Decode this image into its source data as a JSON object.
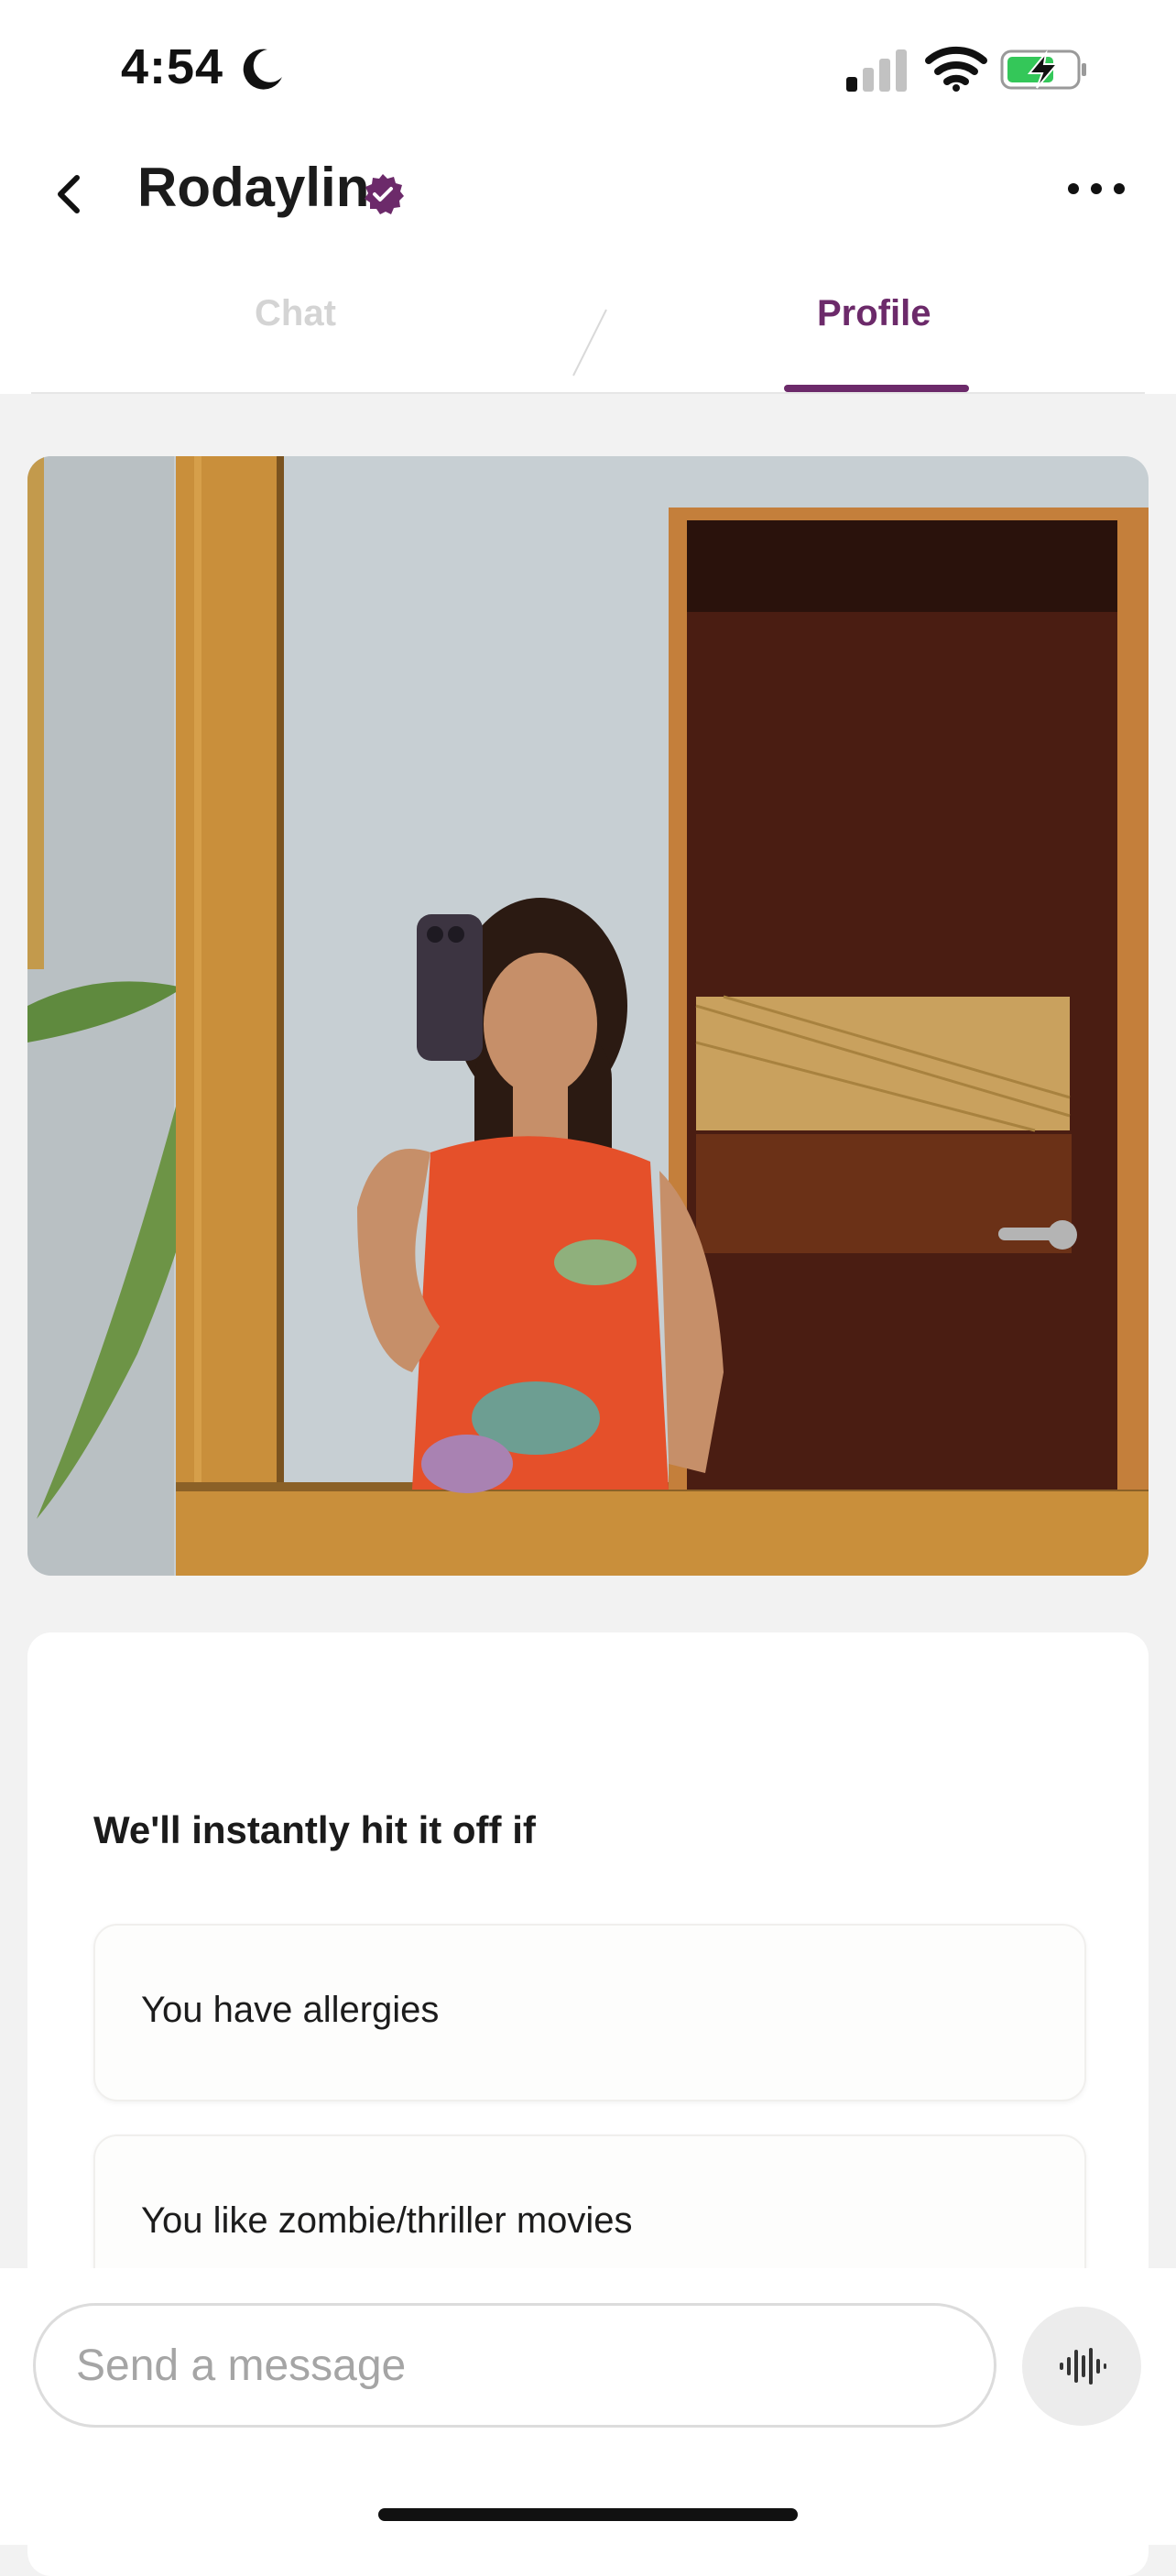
{
  "status_bar": {
    "time": "4:54"
  },
  "header": {
    "title": "Rodaylin"
  },
  "tabs": [
    {
      "label": "Chat"
    },
    {
      "label": "Profile"
    }
  ],
  "profile": {
    "prompt_heading": "We'll instantly hit it off if",
    "prompt_answers": [
      "You have allergies",
      "You like zombie/thriller movies"
    ]
  },
  "composer": {
    "placeholder": "Send a message"
  },
  "colors": {
    "accent": "#6c2a6a",
    "background": "#f2f2f2",
    "verified_badge": "#6c2a6a"
  },
  "icons": {
    "status": [
      "moon-icon",
      "cellular-signal-icon",
      "wifi-icon",
      "battery-charging-icon"
    ],
    "header": [
      "back-chevron-icon",
      "verified-badge-icon",
      "more-options-icon"
    ],
    "composer": [
      "voice-waveform-icon"
    ]
  }
}
